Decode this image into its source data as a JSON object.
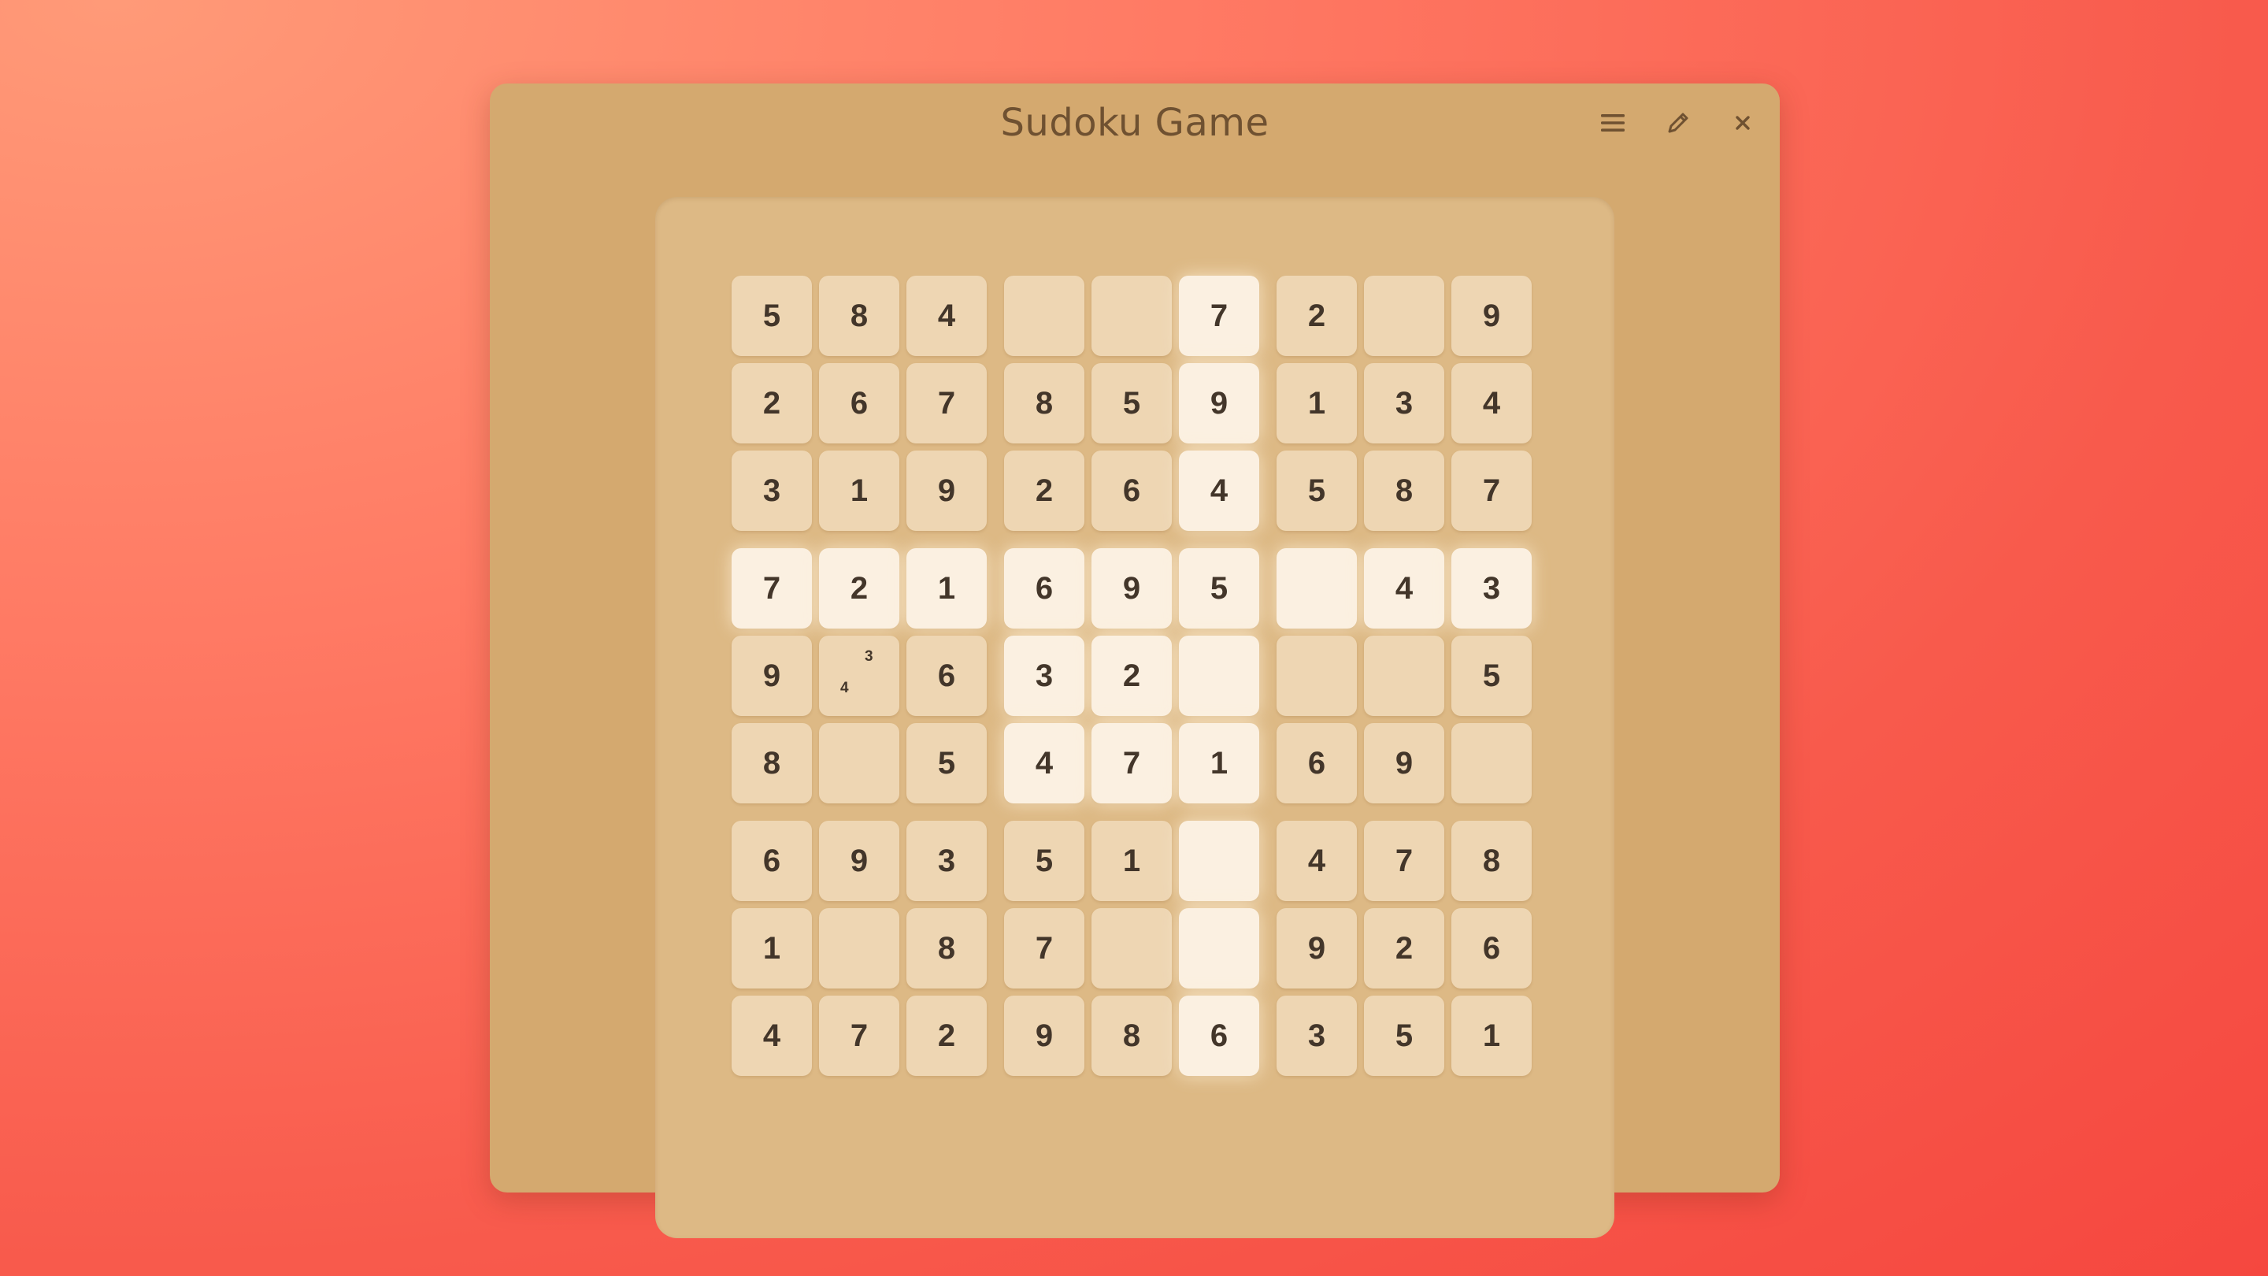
{
  "window": {
    "title": "Sudoku Game"
  },
  "toolbar": {
    "menu_icon": "hamburger-menu-icon",
    "edit_icon": "pencil-icon",
    "close_icon": "close-icon"
  },
  "colors": {
    "background_start": "#ff9a78",
    "background_end": "#f5473f",
    "window": "#d4a96f",
    "board": "#ddb985",
    "cell": "#eed6b3",
    "cell_highlight": "#fbf0e1",
    "text": "#43362a",
    "title": "#6f5131"
  },
  "grid": {
    "rows": [
      [
        "5",
        "8",
        "4",
        "",
        "",
        "7",
        "2",
        "",
        "9"
      ],
      [
        "2",
        "6",
        "7",
        "8",
        "5",
        "9",
        "1",
        "3",
        "4"
      ],
      [
        "3",
        "1",
        "9",
        "2",
        "6",
        "4",
        "5",
        "8",
        "7"
      ],
      [
        "7",
        "2",
        "1",
        "6",
        "9",
        "5",
        "",
        "4",
        "3"
      ],
      [
        "9",
        "",
        "6",
        "3",
        "2",
        "",
        "",
        "",
        "5"
      ],
      [
        "8",
        "",
        "5",
        "4",
        "7",
        "1",
        "6",
        "9",
        ""
      ],
      [
        "6",
        "9",
        "3",
        "5",
        "1",
        "",
        "4",
        "7",
        "8"
      ],
      [
        "1",
        "",
        "8",
        "7",
        "",
        "",
        "9",
        "2",
        "6"
      ],
      [
        "4",
        "7",
        "2",
        "9",
        "8",
        "6",
        "3",
        "5",
        "1"
      ]
    ],
    "highlighted": [
      [
        0,
        5
      ],
      [
        1,
        5
      ],
      [
        2,
        5
      ],
      [
        3,
        0
      ],
      [
        3,
        1
      ],
      [
        3,
        2
      ],
      [
        3,
        3
      ],
      [
        3,
        4
      ],
      [
        3,
        5
      ],
      [
        3,
        6
      ],
      [
        3,
        7
      ],
      [
        3,
        8
      ],
      [
        4,
        3
      ],
      [
        4,
        4
      ],
      [
        4,
        5
      ],
      [
        5,
        3
      ],
      [
        5,
        4
      ],
      [
        5,
        5
      ],
      [
        6,
        5
      ],
      [
        7,
        5
      ],
      [
        8,
        5
      ]
    ],
    "notes": [
      {
        "row": 4,
        "col": 1,
        "values": [
          "3",
          "4"
        ]
      }
    ]
  }
}
